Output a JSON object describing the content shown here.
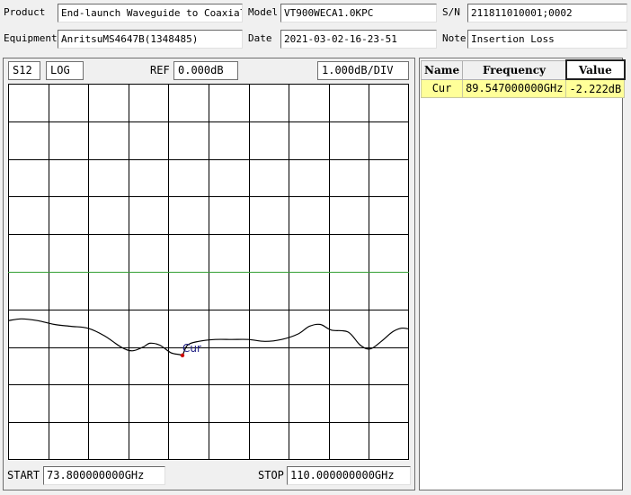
{
  "header": {
    "product_label": "Product",
    "product_value": "End-launch Waveguide to Coaxial",
    "model_label": "Model",
    "model_value": "VT900WECA1.0KPC",
    "sn_label": "S/N",
    "sn_value": "211811010001;0002",
    "equipment_label": "Equipment",
    "equipment_value": "AnritsuMS4647B(1348485)",
    "date_label": "Date",
    "date_value": "2021-03-02-16-23-51",
    "note_label": "Note",
    "note_value": "Insertion Loss"
  },
  "plot": {
    "param": "S12",
    "format": "LOG",
    "ref_label": "REF",
    "ref_value": "0.000dB",
    "scale": "1.000dB/DIV",
    "start_label": "START",
    "start_value": "73.800000000GHz",
    "stop_label": "STOP",
    "stop_value": "110.000000000GHz",
    "marker_label": "Cur",
    "colors": {
      "grid": "#000000",
      "ref_line": "#33a033",
      "trace": "#000000",
      "marker": "#cc0000",
      "marker_text": "#1a1a80"
    }
  },
  "chart_data": {
    "type": "line",
    "x_range": [
      73.8,
      110.0
    ],
    "x_unit": "GHz",
    "y_range": [
      -5,
      5
    ],
    "y_unit": "dB",
    "ref_level": 0,
    "grid": true,
    "divisions": {
      "x": 10,
      "y": 10
    },
    "series": [
      {
        "x": [
          73.8,
          75.0,
          76.5,
          78.0,
          79.5,
          81.0,
          82.5,
          84.0,
          85.0,
          86.0,
          86.6,
          87.5,
          88.5,
          89.3,
          89.547,
          90.0,
          91.0,
          92.5,
          94.0,
          95.5,
          97.0,
          98.5,
          100.0,
          101.0,
          102.0,
          103.0,
          104.5,
          105.6,
          106.5,
          107.5,
          108.5,
          109.3,
          110.0
        ],
        "y": [
          -1.3,
          -1.25,
          -1.3,
          -1.4,
          -1.45,
          -1.5,
          -1.7,
          -2.0,
          -2.1,
          -2.0,
          -1.9,
          -1.95,
          -2.15,
          -2.2,
          -2.222,
          -1.95,
          -1.85,
          -1.8,
          -1.8,
          -1.8,
          -1.85,
          -1.8,
          -1.65,
          -1.45,
          -1.4,
          -1.55,
          -1.6,
          -1.95,
          -2.05,
          -1.85,
          -1.6,
          -1.5,
          -1.52
        ]
      }
    ],
    "marker": {
      "name": "Cur",
      "x": 89.547,
      "y": -2.222
    }
  },
  "markers_table": {
    "headers": [
      "Name",
      "Frequency",
      "Value"
    ],
    "rows": [
      {
        "name": "Cur",
        "frequency": "89.547000000GHz",
        "value": "-2.222dB"
      }
    ]
  }
}
